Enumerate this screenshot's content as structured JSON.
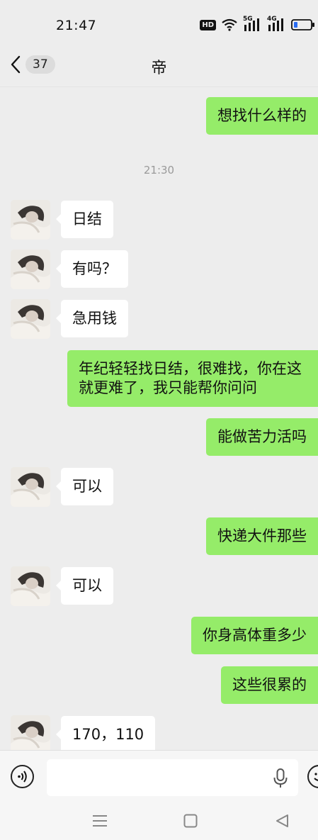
{
  "status_bar": {
    "time": "21:47",
    "hd_label": "HD",
    "network_1": "5G",
    "network_2": "4G"
  },
  "header": {
    "unread_count": "37",
    "title": "帝"
  },
  "colors": {
    "outgoing_bubble": "#95ec69",
    "incoming_bubble": "#ffffff",
    "background": "#ededed"
  },
  "messages": [
    {
      "side": "out",
      "text": "想找什么样的"
    },
    {
      "side": "timestamp",
      "text": "21:30"
    },
    {
      "side": "in",
      "text": "日结"
    },
    {
      "side": "in",
      "text": "有吗？"
    },
    {
      "side": "in",
      "text": "急用钱"
    },
    {
      "side": "out",
      "text": "年纪轻轻找日结，很难找，你在这就更难了，我只能帮你问问"
    },
    {
      "side": "out",
      "text": "能做苦力活吗"
    },
    {
      "side": "in",
      "text": "可以"
    },
    {
      "side": "out",
      "text": "快递大件那些"
    },
    {
      "side": "in",
      "text": "可以"
    },
    {
      "side": "out",
      "text": "你身高体重多少"
    },
    {
      "side": "out",
      "text": "这些很累的"
    },
    {
      "side": "in",
      "text": "170，110"
    }
  ],
  "input_bar": {
    "placeholder": "",
    "voice_icon": "voice-icon",
    "mic_icon": "microphone-icon",
    "emoji_icon": "emoji-icon"
  },
  "system_nav": {
    "menu_icon": "menu-icon",
    "home_icon": "home-icon",
    "back_icon": "back-triangle-icon"
  }
}
